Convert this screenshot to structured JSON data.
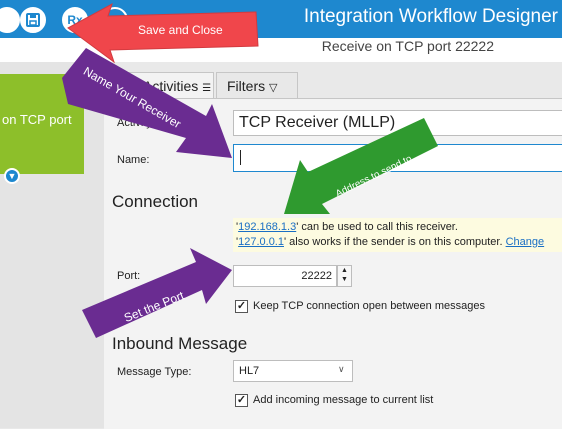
{
  "app": {
    "title": "Integration Workflow Designer",
    "subtitle": "Receive on TCP port 22222",
    "toolbar": {
      "save_icon": "save-icon",
      "save_close_icon": "save-close-icon",
      "rx_label": "Rx"
    }
  },
  "canvas": {
    "node_label": "on TCP port",
    "node_arrow": "chevron-down-icon"
  },
  "tabs": [
    {
      "label": "Activities"
    },
    {
      "label": "Filters"
    }
  ],
  "form": {
    "activity_label": "Activity",
    "activity_value": "TCP Receiver (MLLP)",
    "name_label": "Name:",
    "name_value": "",
    "connection_heading": "Connection",
    "hint": {
      "ip1": "192.168.1.3",
      "ip1_suffix": "' can be used to call this receiver.",
      "ip2": "127.0.0.1",
      "ip2_suffix": "' also works if the sender is on this computer.",
      "change_link": "Change"
    },
    "port_label": "Port:",
    "port_value": "22222",
    "keep_open_label": "Keep TCP connection open between messages",
    "keep_open_checked": true,
    "inbound_heading": "Inbound Message",
    "message_type_label": "Message Type:",
    "message_type_value": "HL7",
    "add_incoming_label": "Add incoming message to current list",
    "add_incoming_checked": true
  },
  "annotations": {
    "save_close": "Save and Close",
    "name_receiver": "Name Your Receiver",
    "address": "Address to send to",
    "set_port": "Set the Port"
  },
  "colors": {
    "title_bar": "#1e88cf",
    "node": "#8dbf2a",
    "red_arrow": "#f0464b",
    "purple_arrow": "#6a2c91",
    "green_arrow": "#2f9a2f"
  }
}
